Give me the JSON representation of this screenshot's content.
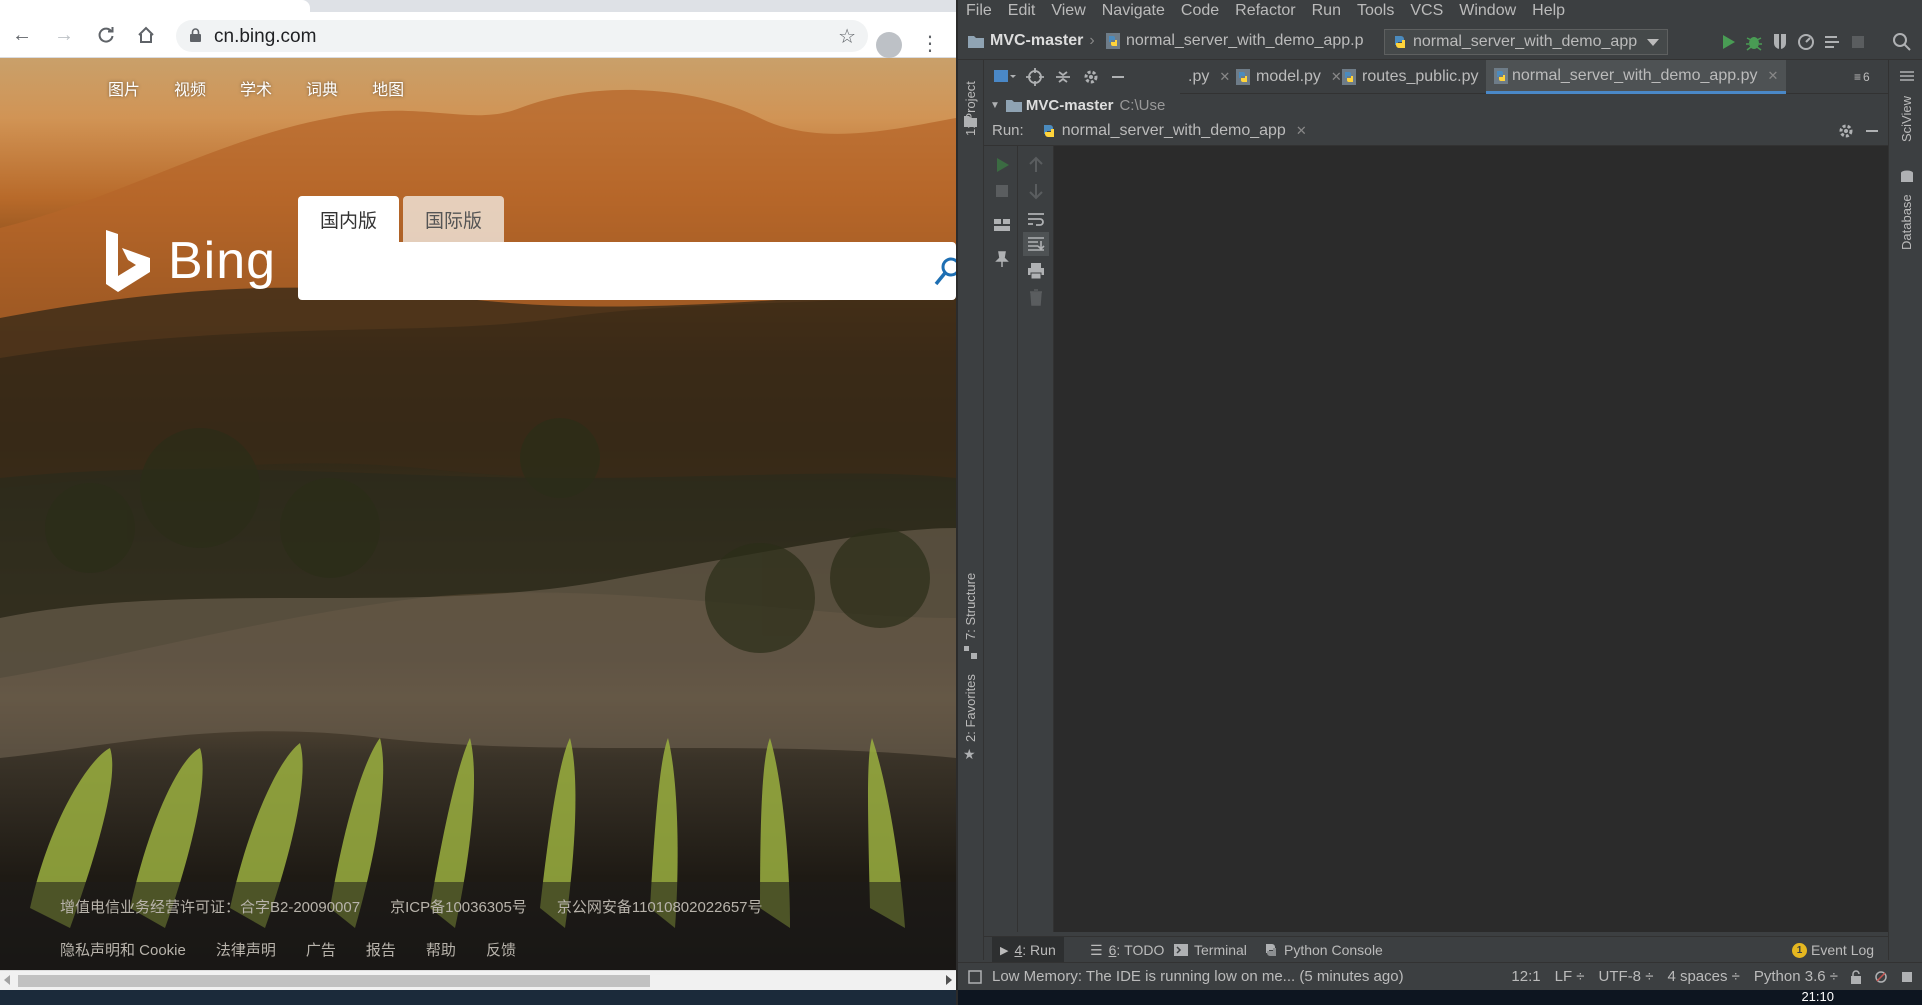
{
  "browser": {
    "url": "cn.bing.com",
    "nav_links": [
      "图片",
      "视频",
      "学术",
      "词典",
      "地图"
    ],
    "logo_text": "Bing",
    "search_tabs": {
      "domestic": "国内版",
      "international": "国际版"
    },
    "search_value": "",
    "footer_row1": [
      "增值电信业务经营许可证：合字B2-20090007",
      "京ICP备10036305号",
      "京公网安备11010802022657号"
    ],
    "footer_row2": [
      "隐私声明和 Cookie",
      "法律声明",
      "广告",
      "报告",
      "帮助",
      "反馈"
    ]
  },
  "ide": {
    "menu": [
      "File",
      "Edit",
      "View",
      "Navigate",
      "Code",
      "Refactor",
      "Run",
      "Tools",
      "VCS",
      "Window",
      "Help"
    ],
    "breadcrumb": {
      "project": "MVC-master",
      "file": "normal_server_with_demo_app.p"
    },
    "run_config": "normal_server_with_demo_app",
    "editor_tabs": [
      {
        "label": ".py",
        "active": false
      },
      {
        "label": "model.py",
        "active": false
      },
      {
        "label": "routes_public.py",
        "active": false
      },
      {
        "label": "normal_server_with_demo_app.py",
        "active": true
      }
    ],
    "tabs_overflow": "6",
    "project_root": {
      "name": "MVC-master",
      "path": "C:\\Usе"
    },
    "run_panel": {
      "label": "Run:",
      "tab": "normal_server_with_demo_app"
    },
    "side_left": {
      "project": "1: Project",
      "structure": "7: Structure",
      "favorites": "2: Favorites"
    },
    "side_right": {
      "sciview": "SciView",
      "database": "Database"
    },
    "bottom_tabs": [
      {
        "key": "4",
        "label": "Run",
        "active": true
      },
      {
        "key": "6",
        "label": "TODO",
        "active": false
      },
      {
        "key": "",
        "label": "Terminal",
        "active": false
      },
      {
        "key": "",
        "label": "Python Console",
        "active": false
      }
    ],
    "event_log": "Event Log",
    "event_count": "1",
    "status_message": "Low Memory: The IDE is running low on me... (5 minutes ago)",
    "status_items": [
      "12:1",
      "LF ÷",
      "UTF-8 ÷",
      "4 spaces ÷",
      "Python 3.6 ÷"
    ],
    "clock": "21:10"
  },
  "colors": {
    "ide_bg": "#3c3f41",
    "console_bg": "#2b2b2b",
    "accent_tab": "#4a88c7",
    "run_green": "#499c54"
  }
}
